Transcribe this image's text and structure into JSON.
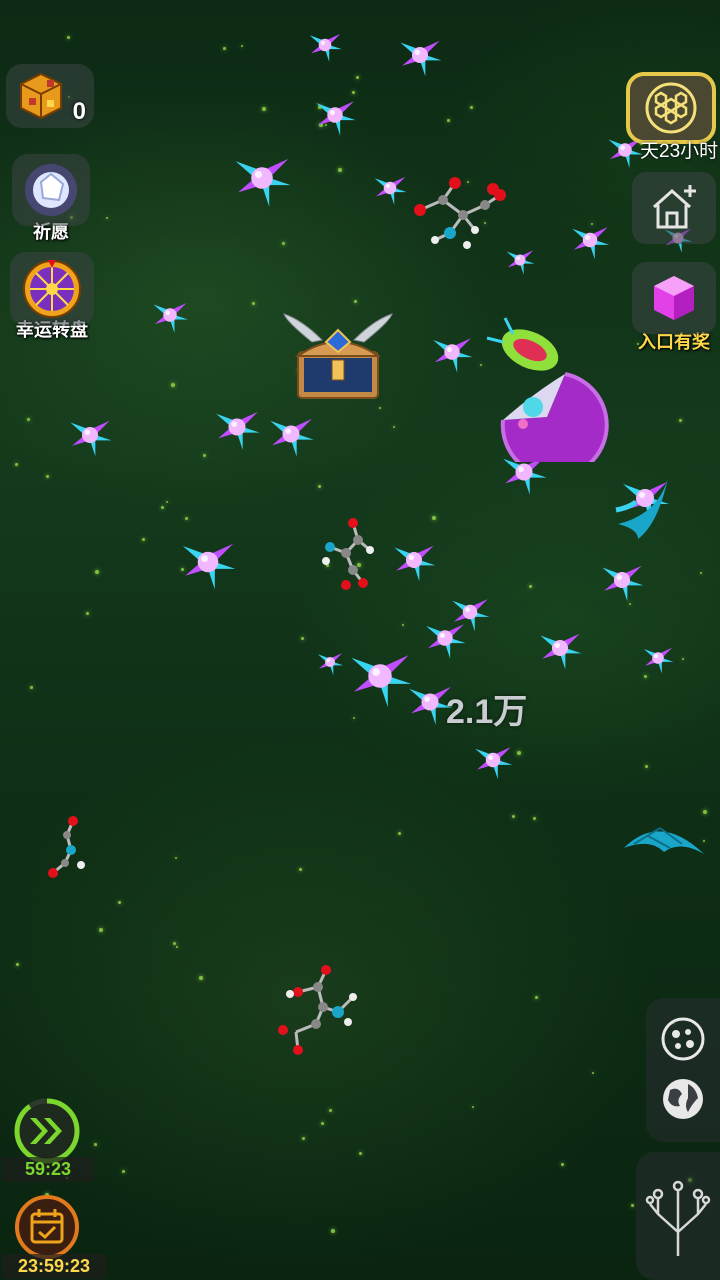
{
  "left_menu": {
    "currency_count": "0",
    "wish_label": "祈愿",
    "wheel_label": "幸运转盘"
  },
  "right_menu": {
    "event_timer": "天23小时",
    "entrance_reward_label": "入口有奖"
  },
  "score_popup": "2.1万",
  "bottom_left": {
    "speed_timer": "59:23",
    "daily_timer": "23:59:23"
  },
  "colors": {
    "orb_core": "#f2b8ff",
    "orb_spike": "#38d4f0",
    "orb_accent": "#c24dff",
    "gold": "#ffd84a",
    "speed_green": "#7bd62e"
  },
  "icons": [
    "golden-cube-icon",
    "crystal-wish-icon",
    "lucky-wheel-icon",
    "honeycomb-icon",
    "house-plus-icon",
    "magenta-cube-icon",
    "cells-icon",
    "globe-icon",
    "evolution-tree-icon",
    "double-chevron-icon",
    "calendar-check-icon"
  ]
}
